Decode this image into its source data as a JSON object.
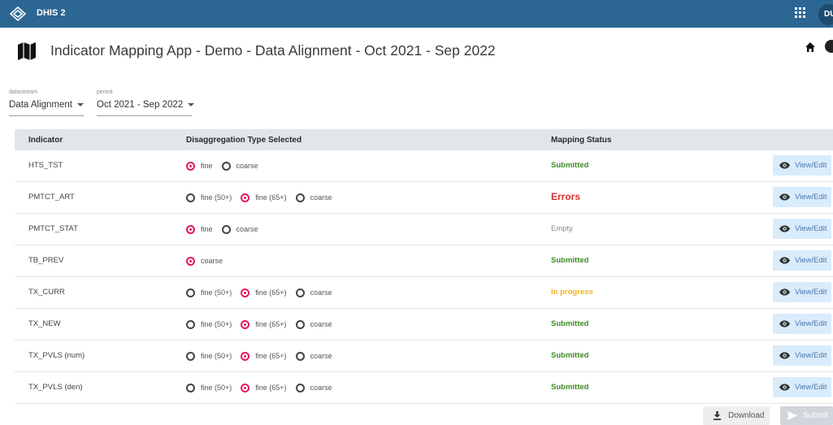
{
  "topbar": {
    "app_name": "DHIS 2",
    "avatar_initials": "DU",
    "logo_icon": "dhis2-logo-icon",
    "apps_icon": "apps-grid-icon"
  },
  "header": {
    "title": "Indicator Mapping App - Demo - Data Alignment - Oct 2021 - Sep 2022",
    "map_icon": "map-icon",
    "home_icon": "home-icon",
    "help_icon": "help-icon"
  },
  "filters": {
    "datastream_label": "datastream",
    "datastream_value": "Data Alignment",
    "period_label": "period",
    "period_value": "Oct 2021 - Sep 2022"
  },
  "table": {
    "headers": [
      "Indicator",
      "Disaggregation Type Selected",
      "Mapping Status"
    ],
    "view_label": "View/Edit",
    "rows": [
      {
        "indicator": "HTS_TST",
        "options": [
          "fine",
          "coarse"
        ],
        "selected": 0,
        "status": "Submitted",
        "status_kind": "submitted"
      },
      {
        "indicator": "PMTCT_ART",
        "options": [
          "fine (50+)",
          "fine (65+)",
          "coarse"
        ],
        "selected": 1,
        "status": "Errors",
        "status_kind": "errors"
      },
      {
        "indicator": "PMTCT_STAT",
        "options": [
          "fine",
          "coarse"
        ],
        "selected": 0,
        "status": "Empty",
        "status_kind": "empty"
      },
      {
        "indicator": "TB_PREV",
        "options": [
          "coarse"
        ],
        "selected": 0,
        "status": "Submitted",
        "status_kind": "submitted"
      },
      {
        "indicator": "TX_CURR",
        "options": [
          "fine (50+)",
          "fine (65+)",
          "coarse"
        ],
        "selected": 1,
        "status": "In progress",
        "status_kind": "progress"
      },
      {
        "indicator": "TX_NEW",
        "options": [
          "fine (50+)",
          "fine (65+)",
          "coarse"
        ],
        "selected": 1,
        "status": "Submitted",
        "status_kind": "submitted"
      },
      {
        "indicator": "TX_PVLS (num)",
        "options": [
          "fine (50+)",
          "fine (65+)",
          "coarse"
        ],
        "selected": 1,
        "status": "Submitted",
        "status_kind": "submitted"
      },
      {
        "indicator": "TX_PVLS (den)",
        "options": [
          "fine (50+)",
          "fine (65+)",
          "coarse"
        ],
        "selected": 1,
        "status": "Submitted",
        "status_kind": "submitted"
      }
    ]
  },
  "actions": {
    "download_label": "Download",
    "submit_label": "Submit"
  },
  "colors": {
    "topbar": "#2c6693",
    "radio_selected": "#e7155e",
    "status_submitted": "#3d8a2b",
    "status_errors": "#d92f2f",
    "status_progress": "#f0b323",
    "view_button": "#d9ecfb"
  }
}
